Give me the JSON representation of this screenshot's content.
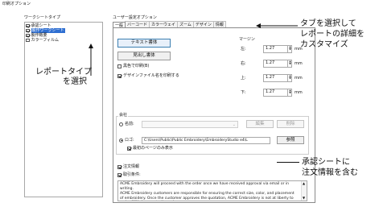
{
  "window": {
    "title": "印刷オプション"
  },
  "left_panel": {
    "header": "ワークシートタイプ",
    "items": [
      {
        "label": "承認シート",
        "checked": true,
        "selected": false
      },
      {
        "label": "製作ワークシート",
        "checked": true,
        "selected": true
      },
      {
        "label": "製作概要",
        "checked": true,
        "selected": false
      },
      {
        "label": "カラーフィルム",
        "checked": false,
        "selected": false
      }
    ]
  },
  "right_panel": {
    "header": "ユーザー設定オプション",
    "tabs": [
      {
        "label": "一般",
        "active": true
      },
      {
        "label": "バーコード",
        "active": false
      },
      {
        "label": "カラーウェイ",
        "active": false
      },
      {
        "label": "ズーム",
        "active": false
      },
      {
        "label": "デザイン",
        "active": false
      },
      {
        "label": "情報",
        "active": false
      }
    ],
    "general": {
      "text_font_button": "テキスト書体",
      "heading_font_button": "見出し書体",
      "print_black": {
        "label": "黒色で印刷(B)",
        "checked": false
      },
      "print_design_filename": {
        "label": "デザインファイル名を印刷する",
        "checked": true
      },
      "margins": {
        "label": "マージン",
        "unit": "mm",
        "fields": [
          {
            "label": "左:",
            "value": "1.27"
          },
          {
            "label": "右:",
            "value": "1.27"
          },
          {
            "label": "上:",
            "value": "1.27"
          },
          {
            "label": "下:",
            "value": "1.27"
          }
        ]
      },
      "company": {
        "label": "会社",
        "name_option": {
          "label": "名前:",
          "selected": false,
          "value": ""
        },
        "edit_button": "編集",
        "delete_button": "削除",
        "logo_option": {
          "label": "ロゴ:",
          "selected": true,
          "value": "C:\\Users\\Public\\Public Embroidery\\EmbroideryStudio e4\\L"
        },
        "browse_button": "参照",
        "first_page_only": {
          "label": "最初のページのみ表示",
          "checked": true
        }
      },
      "order_info": {
        "label": "注文情報",
        "checked": true
      },
      "terms": {
        "label": "取引条件:",
        "checked": true,
        "text": [
          "ACME Embroidery will proceed with the order once we have received approval via email or in writing.",
          "ACME Embroidery customers are responsible for ensuring the correct size, color, and placement of embroidery. Once the customer approves the quotation, ACME Embroidery is not at liberty to make ANY changes to the order."
        ]
      }
    }
  },
  "annotations": {
    "tabs_note": [
      "タブを選択して",
      "レポートの詳細を",
      "カスタマイズ"
    ],
    "report_type_note": [
      "レポートタイプ",
      "を選択"
    ],
    "approval_note": [
      "承認シートに",
      "注文情報を含む"
    ]
  }
}
